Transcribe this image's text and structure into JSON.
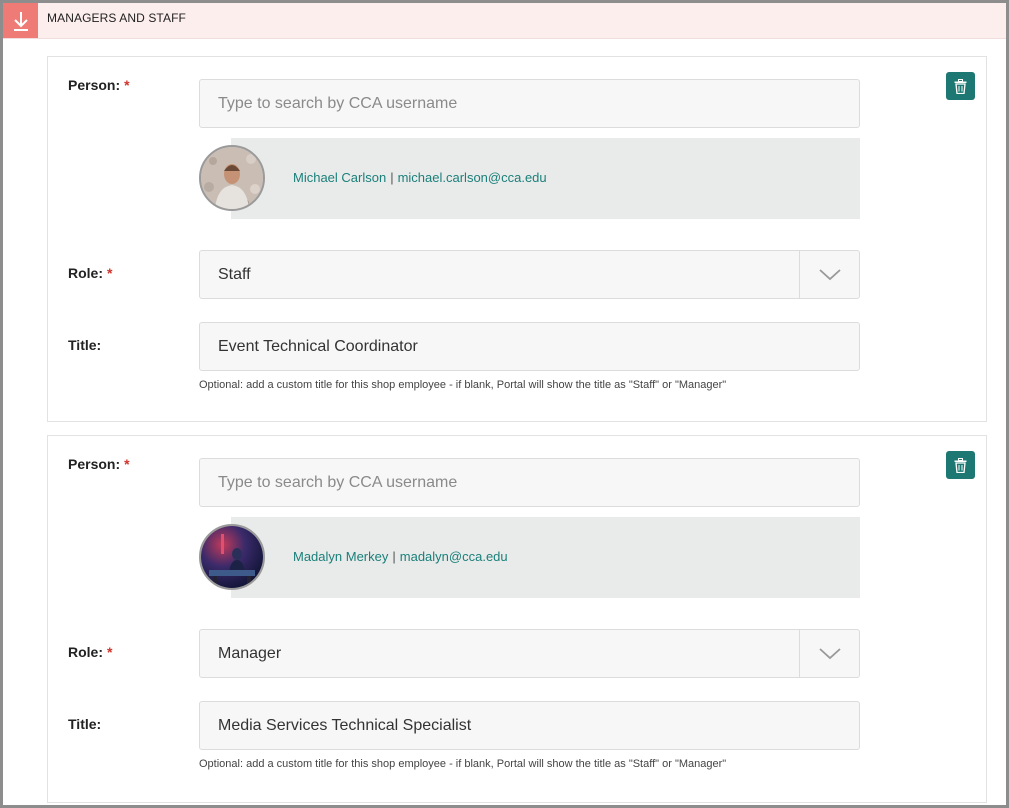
{
  "section": {
    "title": "MANAGERS AND STAFF",
    "collapse_icon": "arrow-down-to-line-icon"
  },
  "colors": {
    "accent": "#1d7873",
    "header_bg": "#fdeeee",
    "header_button": "#ee7b76",
    "required": "#d0342c",
    "link": "#1a7f7a"
  },
  "labels": {
    "person": "Person:",
    "role": "Role:",
    "title": "Title:",
    "required_mark": "*",
    "search_placeholder": "Type to search by CCA username",
    "help": "Optional: add a custom title for this shop employee - if blank, Portal will show the title as \"Staff\" or \"Manager\"",
    "separator": "|"
  },
  "entries": [
    {
      "person": {
        "name": "Michael Carlson",
        "email": "michael.carlson@cca.edu"
      },
      "role": "Staff",
      "title": "Event Technical Coordinator"
    },
    {
      "person": {
        "name": "Madalyn Merkey",
        "email": "madalyn@cca.edu"
      },
      "role": "Manager",
      "title": "Media Services Technical Specialist"
    }
  ]
}
